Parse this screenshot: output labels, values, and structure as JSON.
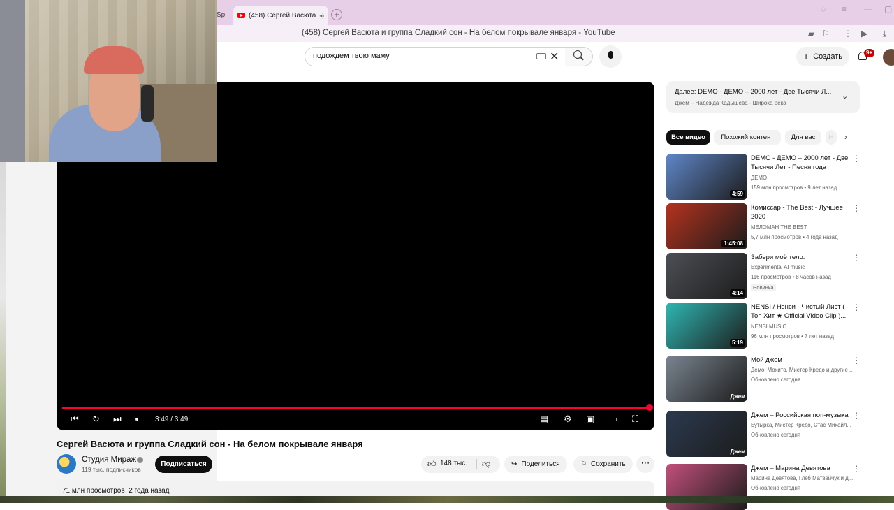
{
  "browser": {
    "prev_tab_label": "Sp",
    "active_tab_title": "(458) Сергей Васюта",
    "window_title": "(458) Сергей Васюта и группа Сладкий сон - На белом покрывале января - YouTube"
  },
  "header": {
    "search_value": "подождем твою маму",
    "create_label": "Создать",
    "notifications_badge": "9+"
  },
  "player": {
    "time": "3:49 / 3:49",
    "progress": 1.0
  },
  "video": {
    "title": "Сергей Васюта и группа Сладкий сон - На белом покрывале января",
    "channel": "Студия Мираж",
    "subscribers": "119 тыс. подписчиков",
    "subscribe_label": "Подписаться",
    "likes": "148 тыс.",
    "share_label": "Поделиться",
    "save_label": "Сохранить",
    "views": "71 млн просмотров",
    "posted": "2 года назад"
  },
  "up_next": {
    "title": "Далее: DEMO - ДЕМО – 2000 лет - Две Тысячи Л...",
    "subtitle": "Джем – Надежда Кадышева - Широка река"
  },
  "chips": [
    "Все видео",
    "Похожий контент",
    "Для вас",
    "Н"
  ],
  "recommendations": [
    {
      "title": "DEMO - ДЕМО – 2000 лет - Две Тысячи Лет - Песня года",
      "channel": "ДЕМО",
      "meta": "159 млн просмотров • 9 лет назад",
      "duration": "4:59",
      "thumb_color": "#5f87c9",
      "badge": ""
    },
    {
      "title": "Комиссар - The Best - Лучшее 2020",
      "channel": "МЕЛОМАН THE BEST",
      "meta": "5,7 млн просмотров • 4 года назад",
      "duration": "1:45:08",
      "thumb_color": "#b5321e",
      "badge": ""
    },
    {
      "title": "Забери моё тело.",
      "channel": "Experimental AI music",
      "meta": "116 просмотров • 8 часов назад",
      "duration": "4:14",
      "thumb_color": "#4d4f55",
      "badge": "Новинка"
    },
    {
      "title": "NENSI / Нэнси - Чистый Лист ( Топ Хит ★ Official Video Clip )...",
      "channel": "NENSI MUSIC",
      "meta": "96 млн просмотров • 7 лет назад",
      "duration": "5:19",
      "thumb_color": "#2fb7b3",
      "badge": ""
    },
    {
      "title": "Мой джем",
      "channel": "Демо, Мохито, Мистер Кредо и другие ...",
      "meta": "Обновлено сегодня",
      "duration": "Джем",
      "thumb_color": "#7a8590",
      "badge": ""
    },
    {
      "title": "Джем – Российская поп-музыка",
      "channel": "Бутырка, Мистер Кредо, Стас Михайл...",
      "meta": "Обновлено сегодня",
      "duration": "Джем",
      "thumb_color": "#2b3a4f",
      "badge": ""
    },
    {
      "title": "Джем – Марина Девятова",
      "channel": "Марина Девятова, Глеб Матвейчук и д...",
      "meta": "Обновлено сегодня",
      "duration": "",
      "thumb_color": "#c24f7a",
      "badge": ""
    }
  ]
}
